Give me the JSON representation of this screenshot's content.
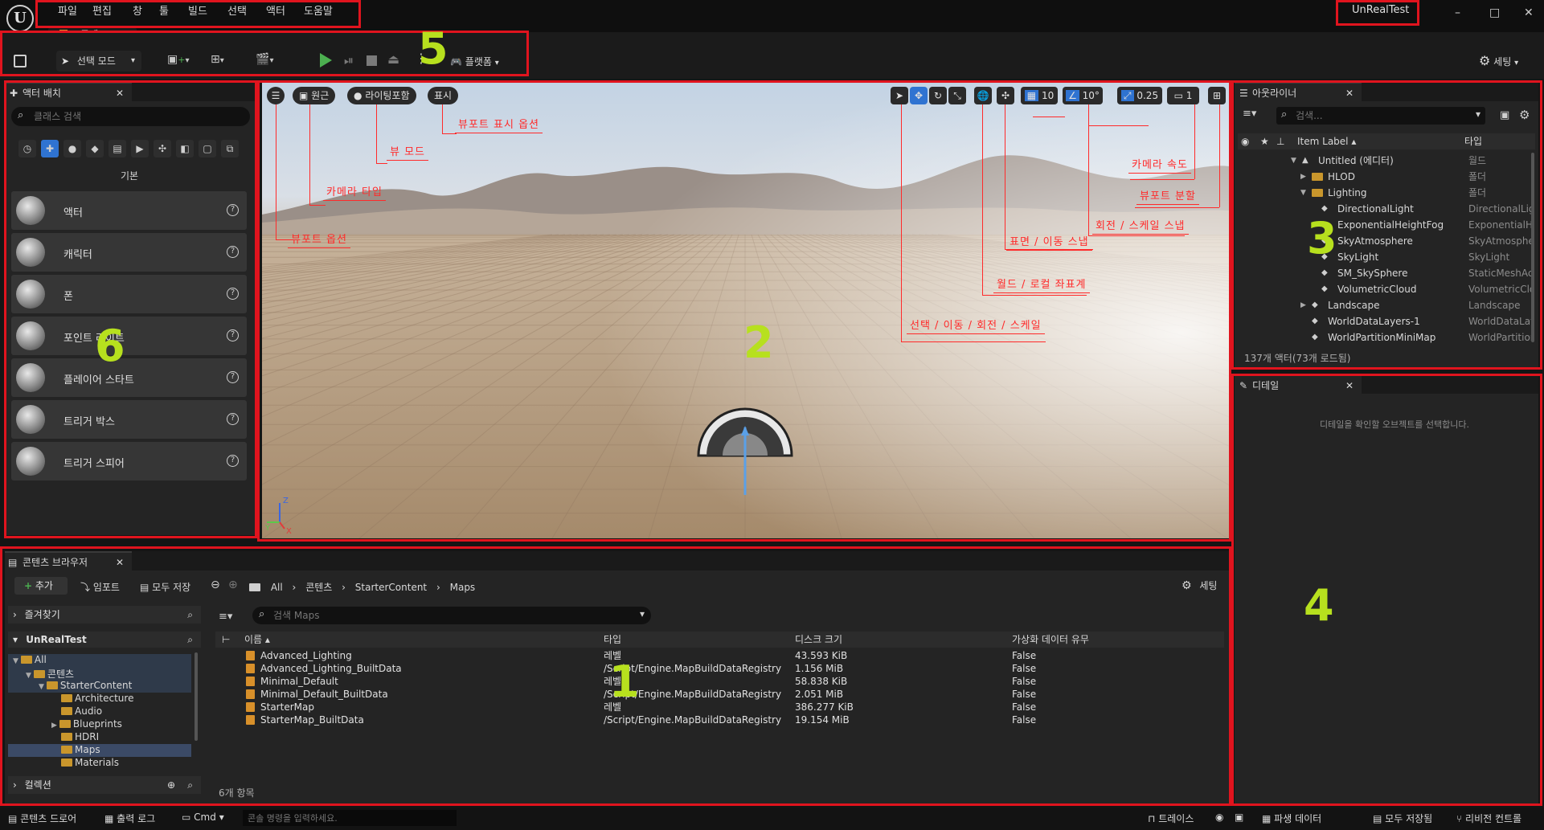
{
  "menu": [
    "파일",
    "편집",
    "창",
    "툴",
    "빌드",
    "선택",
    "액터",
    "도움말"
  ],
  "project_name": "UnRealTest",
  "level_tab": "무제",
  "window_controls": {
    "minimize": "–",
    "maximize": "□",
    "close": "✕"
  },
  "toolbar": {
    "select_mode": "선택 모드",
    "platform": "플랫폼",
    "settings": "세팅"
  },
  "place_actors": {
    "tab": "액터 배치",
    "search_placeholder": "클래스 검색",
    "category": "기본",
    "items": [
      {
        "label": "액터",
        "icon": "sphere-icon"
      },
      {
        "label": "캐릭터",
        "icon": "character-icon"
      },
      {
        "label": "폰",
        "icon": "pawn-icon"
      },
      {
        "label": "포인트 라이트",
        "icon": "light-bulb-icon"
      },
      {
        "label": "플레이어 스타트",
        "icon": "player-start-icon"
      },
      {
        "label": "트리거 박스",
        "icon": "trigger-box-icon"
      },
      {
        "label": "트리거 스피어",
        "icon": "trigger-sphere-icon"
      }
    ]
  },
  "viewport": {
    "perspective": "원근",
    "lighting": "라이팅포함",
    "show": "표시",
    "grid_snap": "10",
    "rotation_snap": "10°",
    "scale_snap": "0.25",
    "camera_speed": "1",
    "annotations": {
      "show_options": "뷰포트 표시 옵션",
      "view_mode": "뷰 모드",
      "camera_type": "카메라 타입",
      "viewport_options": "뷰포트 옵션",
      "camera_speed": "카메라 속도",
      "viewport_layout": "뷰포트 분할",
      "rotate_scale_snap": "회전 / 스케일 스냅",
      "surface_move_snap": "표면 / 이동 스냅",
      "world_local": "월드 / 로컬 좌표계",
      "transform_tools": "선택 / 이동 / 회전 / 스케일"
    },
    "axis_labels": {
      "x": "X",
      "y": "Y",
      "z": "Z"
    }
  },
  "outliner": {
    "tab": "아웃라이너",
    "search_placeholder": "검색...",
    "col_label": "Item Label ▴",
    "col_type": "타입",
    "rows": [
      {
        "name": "Untitled (에디터)",
        "type": "월드",
        "indent": 0,
        "kind": "world"
      },
      {
        "name": "HLOD",
        "type": "폴더",
        "indent": 1,
        "kind": "folder"
      },
      {
        "name": "Lighting",
        "type": "폴더",
        "indent": 1,
        "kind": "folder"
      },
      {
        "name": "DirectionalLight",
        "type": "DirectionalLight",
        "indent": 2,
        "kind": "actor"
      },
      {
        "name": "ExponentialHeightFog",
        "type": "ExponentialHeightFog",
        "indent": 2,
        "kind": "actor"
      },
      {
        "name": "SkyAtmosphere",
        "type": "SkyAtmosphere",
        "indent": 2,
        "kind": "actor"
      },
      {
        "name": "SkyLight",
        "type": "SkyLight",
        "indent": 2,
        "kind": "actor"
      },
      {
        "name": "SM_SkySphere",
        "type": "StaticMeshActor",
        "indent": 2,
        "kind": "actor"
      },
      {
        "name": "VolumetricCloud",
        "type": "VolumetricCloud",
        "indent": 2,
        "kind": "actor"
      },
      {
        "name": "Landscape",
        "type": "Landscape",
        "indent": 1,
        "kind": "actor"
      },
      {
        "name": "WorldDataLayers-1",
        "type": "WorldDataLayers",
        "indent": 1,
        "kind": "actor"
      },
      {
        "name": "WorldPartitionMiniMap",
        "type": "WorldPartitionMiniMap",
        "indent": 1,
        "kind": "actor"
      }
    ],
    "footer": "137개 액터(73개 로드됨)"
  },
  "details": {
    "tab": "디테일",
    "empty_message": "디테일을 확인할 오브젝트를 선택합니다."
  },
  "content_browser": {
    "tab": "콘텐츠 브라우저",
    "add": "추가",
    "import": "임포트",
    "save_all": "모두 저장",
    "settings": "세팅",
    "breadcrumb": [
      "All",
      "콘텐츠",
      "StarterContent",
      "Maps"
    ],
    "favorites": "즐겨찾기",
    "project": "UnRealTest",
    "collections": "컬렉션",
    "search_placeholder": "검색 Maps",
    "tree": [
      {
        "name": "All",
        "indent": 0
      },
      {
        "name": "콘텐츠",
        "indent": 1
      },
      {
        "name": "StarterContent",
        "indent": 2
      },
      {
        "name": "Architecture",
        "indent": 3
      },
      {
        "name": "Audio",
        "indent": 3
      },
      {
        "name": "Blueprints",
        "indent": 3
      },
      {
        "name": "HDRI",
        "indent": 3
      },
      {
        "name": "Maps",
        "indent": 3,
        "selected": true
      },
      {
        "name": "Materials",
        "indent": 3
      }
    ],
    "columns": [
      "이름 ▴",
      "타입",
      "디스크 크기",
      "가상화 데이터 유무"
    ],
    "files": [
      {
        "name": "Advanced_Lighting",
        "type": "레벨",
        "size": "43.593 KiB",
        "virtualized": "False"
      },
      {
        "name": "Advanced_Lighting_BuiltData",
        "type": "/Script/Engine.MapBuildDataRegistry",
        "size": "1.156 MiB",
        "virtualized": "False"
      },
      {
        "name": "Minimal_Default",
        "type": "레벨",
        "size": "58.838 KiB",
        "virtualized": "False"
      },
      {
        "name": "Minimal_Default_BuiltData",
        "type": "/Script/Engine.MapBuildDataRegistry",
        "size": "2.051 MiB",
        "virtualized": "False"
      },
      {
        "name": "StarterMap",
        "type": "레벨",
        "size": "386.277 KiB",
        "virtualized": "False"
      },
      {
        "name": "StarterMap_BuiltData",
        "type": "/Script/Engine.MapBuildDataRegistry",
        "size": "19.154 MiB",
        "virtualized": "False"
      }
    ],
    "item_count": "6개 항목"
  },
  "statusbar": {
    "content_drawer": "콘텐츠 드로어",
    "output_log": "출력 로그",
    "cmd": "Cmd",
    "console_placeholder": "콘솔 명령을 입력하세요.",
    "trace": "트레이스",
    "derived_data": "파생 데이터",
    "save_all": "모두 저장됨",
    "revision_control": "리비전 컨트롤"
  },
  "region_numbers": [
    "1",
    "2",
    "3",
    "4",
    "5",
    "6"
  ],
  "colors": {
    "annotation": "#e0141e",
    "region_number": "#b7e01e",
    "folder": "#c9962c",
    "accent": "#2f73d1",
    "play": "#4caf50"
  }
}
